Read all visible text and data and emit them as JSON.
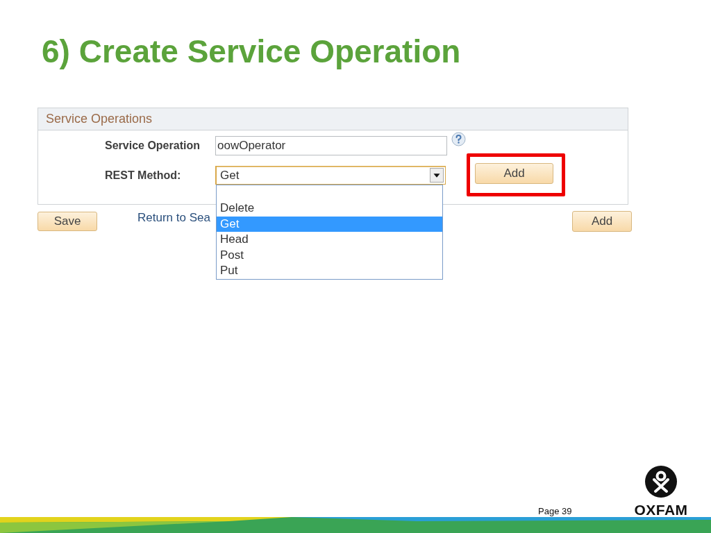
{
  "slide": {
    "title": "6) Create Service Operation",
    "page_number": "Page 39",
    "logo_text": "OXFAM"
  },
  "panel": {
    "title": "Service Operations",
    "fields": [
      {
        "kind": "text",
        "label": "Service Operation",
        "value": "oowOperator"
      },
      {
        "kind": "select",
        "label": "REST Method:",
        "value": "Get",
        "expanded": true,
        "options": [
          {
            "label": "Delete",
            "selected": false
          },
          {
            "label": "Get",
            "selected": true
          },
          {
            "label": "Head",
            "selected": false
          },
          {
            "label": "Post",
            "selected": false
          },
          {
            "label": "Put",
            "selected": false
          }
        ]
      }
    ],
    "add_button": {
      "label": "Add",
      "highlighted": true
    }
  },
  "actions": {
    "save": "Save",
    "return_link": "Return to Sea",
    "add": "Add"
  }
}
